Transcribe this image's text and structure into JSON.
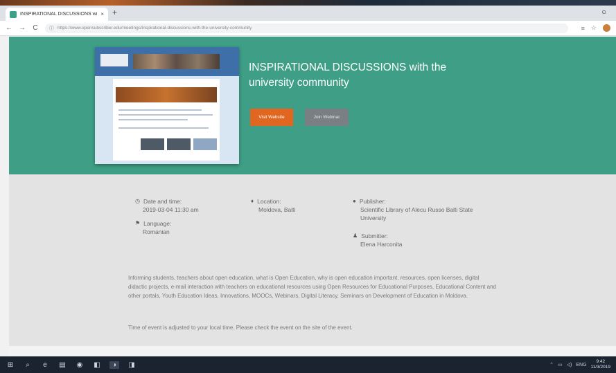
{
  "browser": {
    "tab_title": "INSPIRATIONAL DISCUSSIONS with",
    "tab_close": "×",
    "new_tab": "+",
    "window_control": "⊙",
    "nav": {
      "back": "←",
      "forward": "→",
      "reload": "C"
    },
    "lock": "ⓘ",
    "url": "https://www.opensubscriber.edu/meetings/inspirational-discussions-with-the-university-community",
    "toolbar_icons": [
      "≡",
      "☆"
    ]
  },
  "hero": {
    "title": "INSPIRATIONAL DISCUSSIONS with the university community",
    "visit_button": "Visit Website",
    "join_button": "Join Webinar"
  },
  "details": {
    "date_label": "Date and time:",
    "date_value": "2019-03-04 11:30 am",
    "language_label": "Language:",
    "language_value": "Romanian",
    "location_label": "Location:",
    "location_value": "Moldova, Balti",
    "publisher_label": "Publisher:",
    "publisher_value": "Scientific Library of Alecu Russo Balti State University",
    "submitter_label": "Submitter:",
    "submitter_value": "Elena Harconita",
    "description": "Informing students, teachers about open education, what is Open Education, why is open education important, resources, open licenses, digital didactic projects, e-mail interaction with teachers on educational resources using Open Resources for Educational Purposes, Educational Content and other portals, Youth Education Ideas, Innovations, MOOCs, Webinars, Digital Literacy, Seminars on Development of Education in Moldova.",
    "note": "Time of event is adjusted to your local time. Please check the event on the site of the event."
  },
  "taskbar": {
    "start": "⊞",
    "search": "⌕",
    "apps": [
      "e",
      "▤",
      "◉",
      "◧",
      "◑",
      "◨"
    ],
    "tray_icons": [
      "⌃",
      "▭",
      "◁)",
      "ENG"
    ],
    "time": "9:42",
    "date": "11/3/2019"
  }
}
